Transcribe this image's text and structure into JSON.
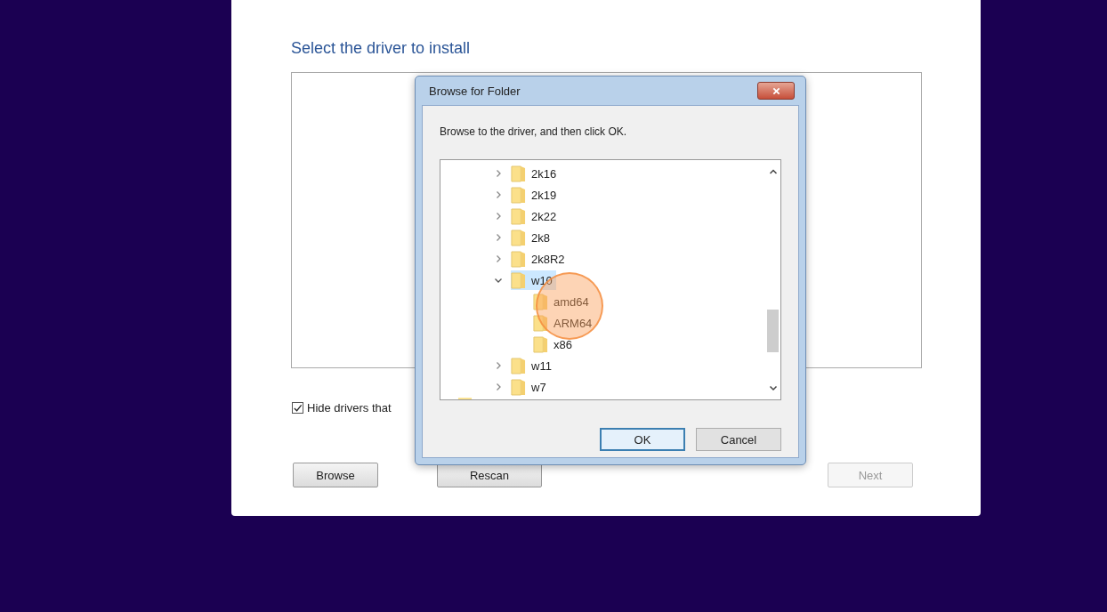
{
  "page": {
    "heading": "Select the driver to install",
    "hide_checkbox": {
      "label": "Hide drivers that",
      "checked": true
    },
    "buttons": [
      {
        "label": "Browse",
        "disabled": false
      },
      {
        "label": "Rescan",
        "disabled": false
      },
      {
        "label": "Next",
        "disabled": true
      }
    ]
  },
  "dialog": {
    "title": "Browse for Folder",
    "instruction": "Browse to the driver, and then click OK.",
    "tree": [
      {
        "label": "2k16",
        "expandable": true,
        "expanded": false,
        "selected": false
      },
      {
        "label": "2k19",
        "expandable": true,
        "expanded": false,
        "selected": false
      },
      {
        "label": "2k22",
        "expandable": true,
        "expanded": false,
        "selected": false
      },
      {
        "label": "2k8",
        "expandable": true,
        "expanded": false,
        "selected": false
      },
      {
        "label": "2k8R2",
        "expandable": true,
        "expanded": false,
        "selected": false
      },
      {
        "label": "w10",
        "expandable": true,
        "expanded": true,
        "selected": true,
        "children": [
          {
            "label": "amd64",
            "expandable": false,
            "expanded": false,
            "selected": false
          },
          {
            "label": "ARM64",
            "expandable": false,
            "expanded": false,
            "selected": false
          },
          {
            "label": "x86",
            "expandable": false,
            "expanded": false,
            "selected": false
          }
        ]
      },
      {
        "label": "w11",
        "expandable": true,
        "expanded": false,
        "selected": false
      },
      {
        "label": "w7",
        "expandable": true,
        "expanded": false,
        "selected": false
      }
    ],
    "buttons": [
      {
        "label": "OK",
        "default": true
      },
      {
        "label": "Cancel",
        "default": false
      }
    ]
  }
}
